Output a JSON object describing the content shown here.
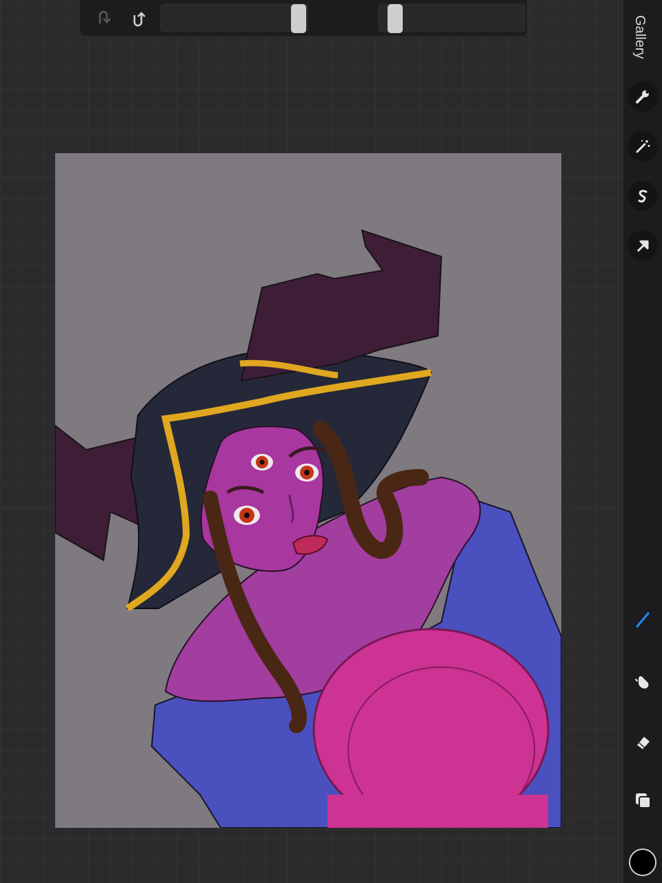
{
  "app": {
    "sidebar": {
      "gallery_label": "Gallery",
      "tools": [
        {
          "name": "actions",
          "icon": "wrench-icon"
        },
        {
          "name": "adjustments",
          "icon": "magic-wand-icon"
        },
        {
          "name": "selection",
          "icon": "selection-s-icon"
        },
        {
          "name": "transform",
          "icon": "arrow-cursor-icon"
        },
        {
          "name": "brush",
          "icon": "brush-icon",
          "active": true,
          "accent": "#1e86ff"
        },
        {
          "name": "smudge",
          "icon": "smudge-finger-icon"
        },
        {
          "name": "eraser",
          "icon": "eraser-icon"
        },
        {
          "name": "layers",
          "icon": "layers-icon"
        }
      ],
      "current_color": "#000000"
    },
    "toolbar": {
      "undo_icon": "undo-icon",
      "redo_icon": "redo-icon",
      "modifier_icon": "square-modifier-icon"
    },
    "colors": {
      "background": "#2b2b2d",
      "chrome": "#1c1c1e",
      "canvas": "#7f7a80",
      "skin": "#a23ea0",
      "hat": "#252838",
      "hat_trim": "#e0a720",
      "horn": "#3e1e36",
      "hair": "#4a2714",
      "cloth": "#4b50bf",
      "hat_pink": "#cc3392"
    }
  }
}
